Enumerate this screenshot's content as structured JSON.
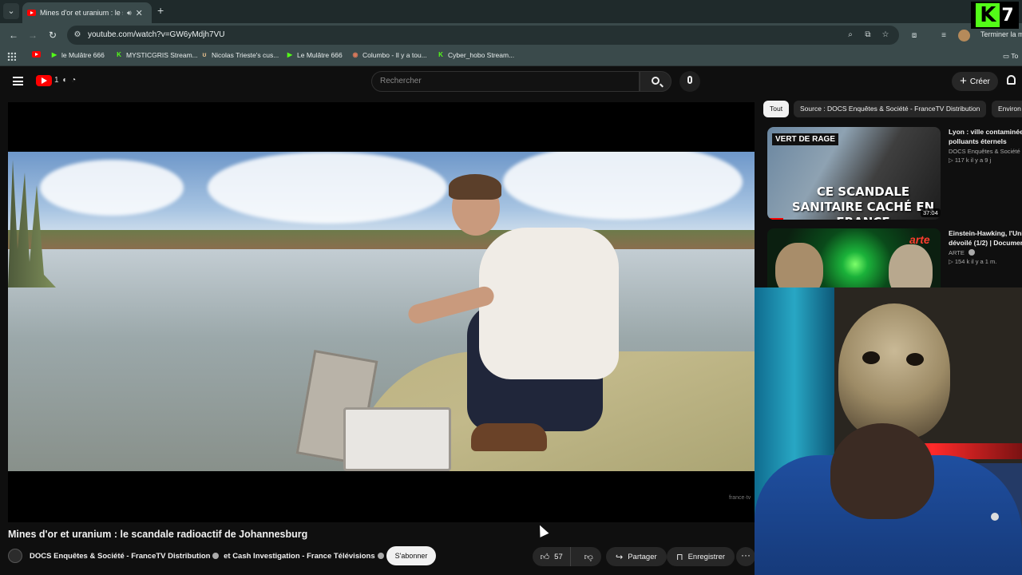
{
  "browser": {
    "tab_title": "Mines d'or et uranium : le s",
    "url": "youtube.com/watch?v=GW6yMdjh7VU",
    "finish_button": "Terminer la m",
    "bookmarks": [
      {
        "label": "le Mulâtre 666",
        "icon": "play-icon",
        "color": "#53fc18"
      },
      {
        "label": "MYSTICGRIS Stream...",
        "icon": "kick-icon",
        "color": "#53fc18"
      },
      {
        "label": "Nicolas Trieste's cus...",
        "icon": "rabbit-icon",
        "color": "#e9c18f"
      },
      {
        "label": "Le Mulâtre 666",
        "icon": "play-icon",
        "color": "#53fc18"
      },
      {
        "label": "Columbo - Il y a tou...",
        "icon": "globe-icon",
        "color": "#d7795b"
      },
      {
        "label": "Cyber_hobo Stream...",
        "icon": "kick-icon",
        "color": "#53fc18"
      }
    ],
    "bookmarks_folder": "To"
  },
  "overlay": {
    "kick_letter": "K",
    "kick_number": "7"
  },
  "youtube": {
    "logo_doodle": "1 ◐ ◔",
    "search_placeholder": "Rechercher",
    "create_label": "Créer"
  },
  "video": {
    "title": "Mines d'or et uranium : le scandale radioactif de Johannesburg",
    "watermark": "france·tv",
    "channel_1": "DOCS Enquêtes & Société - FranceTV Distribution",
    "and": "et",
    "channel_2": "Cash Investigation - France Télévisions",
    "subscribe": "S'abonner",
    "likes": "57",
    "share": "Partager",
    "save": "Enregistrer",
    "more": "···"
  },
  "chips": [
    "Tout",
    "Source : DOCS Enquêtes & Société - FranceTV Distribution",
    "Environ"
  ],
  "recommendations": [
    {
      "thumb_label": "VERT DE RAGE",
      "thumb_headline": "CE SCANDALE SANITAIRE CACHÉ EN FRANCE",
      "duration": "37:04",
      "title_line1": "Lyon : ville contaminée",
      "title_line2": "polluants éternels",
      "channel": "DOCS Enquêtes & Société -",
      "views": "▷ 117 k  il y a 9 j"
    },
    {
      "thumb_label": "arte",
      "title_line1": "Einstein-Hawking, l'Univ",
      "title_line2": "dévoilé (1/2) | Documen",
      "channel": "ARTE",
      "views": "▷ 154 k  il y a 1 m."
    }
  ]
}
